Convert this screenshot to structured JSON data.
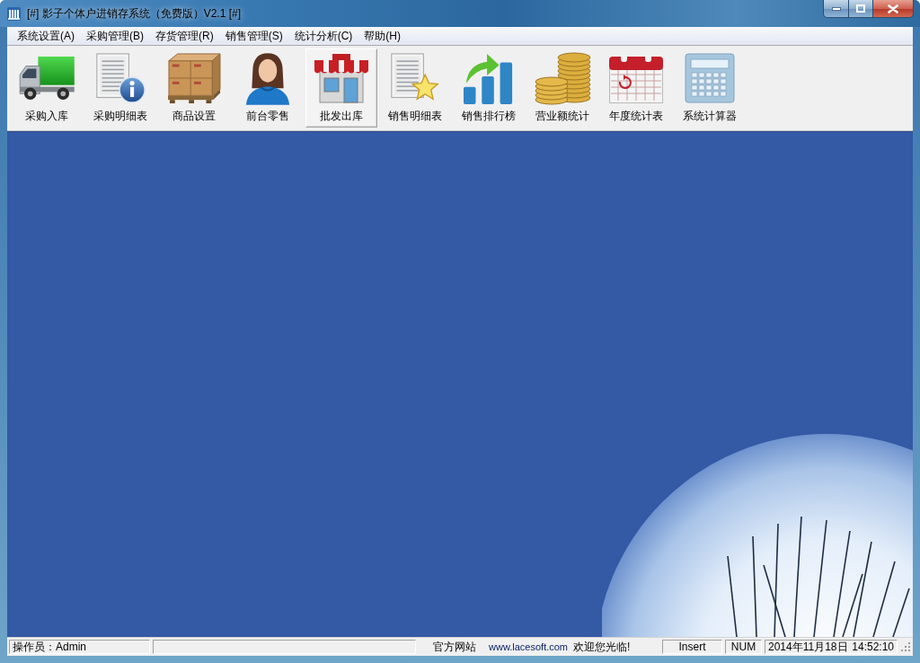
{
  "window": {
    "title": "[#] 影子个体户进销存系统（免费版）V2.1 [#]"
  },
  "menu": [
    "系统设置(A)",
    "采购管理(B)",
    "存货管理(R)",
    "销售管理(S)",
    "统计分析(C)",
    "帮助(H)"
  ],
  "toolbar": [
    {
      "kind": "truck",
      "label": "采购入库",
      "selected": false
    },
    {
      "kind": "document-info",
      "label": "采购明细表",
      "selected": false
    },
    {
      "kind": "boxes",
      "label": "商品设置",
      "selected": false
    },
    {
      "kind": "person",
      "label": "前台零售",
      "selected": false
    },
    {
      "kind": "shop",
      "label": "批发出库",
      "selected": true
    },
    {
      "kind": "document-star",
      "label": "销售明细表",
      "selected": false
    },
    {
      "kind": "bar-chart",
      "label": "销售排行榜",
      "selected": false
    },
    {
      "kind": "coins",
      "label": "营业额统计",
      "selected": false
    },
    {
      "kind": "calendar",
      "label": "年度统计表",
      "selected": false
    },
    {
      "kind": "calculator",
      "label": "系统计算器",
      "selected": false
    }
  ],
  "status_bar": {
    "operator": "操作员：Admin",
    "website_label": "官方网站",
    "website_link": "www.lacesoft.com",
    "welcome": "欢迎您光临!",
    "insert": "Insert",
    "num": "NUM",
    "date": "2014年11月18日",
    "time": "14:52:10"
  }
}
